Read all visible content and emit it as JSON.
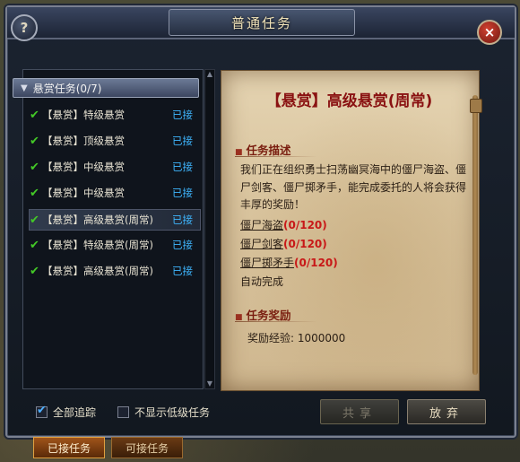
{
  "window": {
    "title": "普通任务",
    "help_symbol": "?",
    "close_symbol": "×"
  },
  "quest_list": {
    "group_label": "悬赏任务(0/7)",
    "items": [
      {
        "name": "【悬赏】特级悬赏",
        "status": "已接"
      },
      {
        "name": "【悬赏】顶级悬赏",
        "status": "已接"
      },
      {
        "name": "【悬赏】中级悬赏",
        "status": "已接"
      },
      {
        "name": "【悬赏】中级悬赏",
        "status": "已接"
      },
      {
        "name": "【悬赏】高级悬赏(周常)",
        "status": "已接",
        "selected": true
      },
      {
        "name": "【悬赏】特级悬赏(周常)",
        "status": "已接"
      },
      {
        "name": "【悬赏】高级悬赏(周常)",
        "status": "已接"
      }
    ]
  },
  "detail": {
    "title": "【悬赏】高级悬赏(周常)",
    "desc_heading": "任务描述",
    "description": "我们正在组织勇士扫荡幽冥海中的僵尸海盗、僵尸剑客、僵尸掷矛手，能完成委托的人将会获得丰厚的奖励！",
    "targets": [
      {
        "name": "僵尸海盗",
        "count": "(0/120)"
      },
      {
        "name": "僵尸剑客",
        "count": "(0/120)"
      },
      {
        "name": "僵尸掷矛手",
        "count": "(0/120)"
      }
    ],
    "auto_complete": "自动完成",
    "reward_heading": "任务奖励",
    "reward_exp": "奖励经验: 1000000"
  },
  "options": {
    "track_all": {
      "label": "全部追踪",
      "checked": true
    },
    "hide_low": {
      "label": "不显示低级任务",
      "checked": false
    }
  },
  "buttons": {
    "share": "共享",
    "abandon": "放弃"
  },
  "tabs": {
    "accepted": "已接任务",
    "available": "可接任务"
  },
  "colors": {
    "check": "#43c827",
    "status": "#3fb7ff",
    "count": "#c81818",
    "title": "#8a1212"
  }
}
